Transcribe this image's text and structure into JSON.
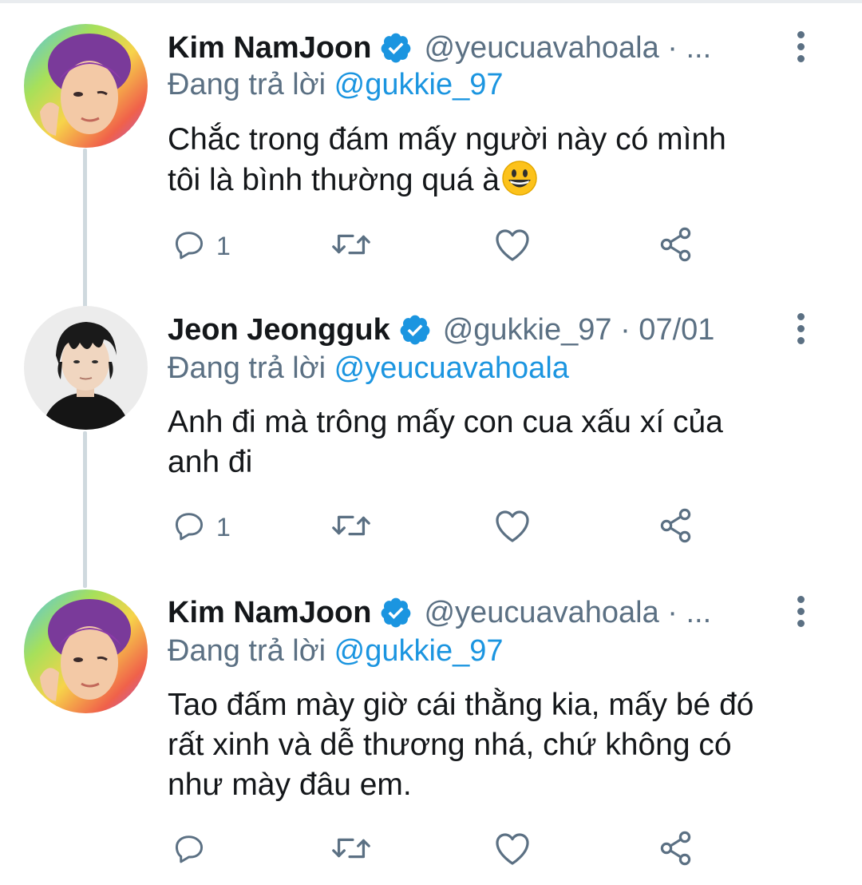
{
  "tweets": [
    {
      "name": "Kim NamJoon",
      "handle_time": "@yeucuavahoala · ...",
      "reply_prefix": "Đang trả lời",
      "reply_to": "@gukkie_97",
      "text_lines": [
        "Chắc trong đám mấy người này có mình",
        "tôi là bình thường quá à"
      ],
      "emoji": "grinning-face",
      "reply_count": "1",
      "retweet_count": "",
      "like_count": ""
    },
    {
      "name": "Jeon Jeongguk",
      "handle_time": "@gukkie_97 · 07/01",
      "reply_prefix": "Đang trả lời",
      "reply_to": "@yeucuavahoala",
      "text_lines": [
        "Anh đi mà trông mấy con cua xấu xí của",
        "anh đi"
      ],
      "reply_count": "1",
      "retweet_count": "",
      "like_count": ""
    },
    {
      "name": "Kim NamJoon",
      "handle_time": "@yeucuavahoala · ...",
      "reply_prefix": "Đang trả lời",
      "reply_to": "@gukkie_97",
      "text_lines": [
        "Tao đấm mày giờ cái thằng kia, mấy bé đó",
        "rất xinh và dễ thương nhá, chứ không có",
        "như mày đâu em."
      ],
      "reply_count": "",
      "retweet_count": "",
      "like_count": ""
    }
  ],
  "icons": {
    "verified": "verified-badge-icon",
    "more": "more-vertical-icon",
    "reply": "reply-icon",
    "retweet": "retweet-icon",
    "like": "heart-icon",
    "share": "share-icon"
  },
  "colors": {
    "accent": "#1b95e0",
    "secondary_text": "#5b7083",
    "primary_text": "#14171a",
    "thread_line": "#cfd9de"
  }
}
